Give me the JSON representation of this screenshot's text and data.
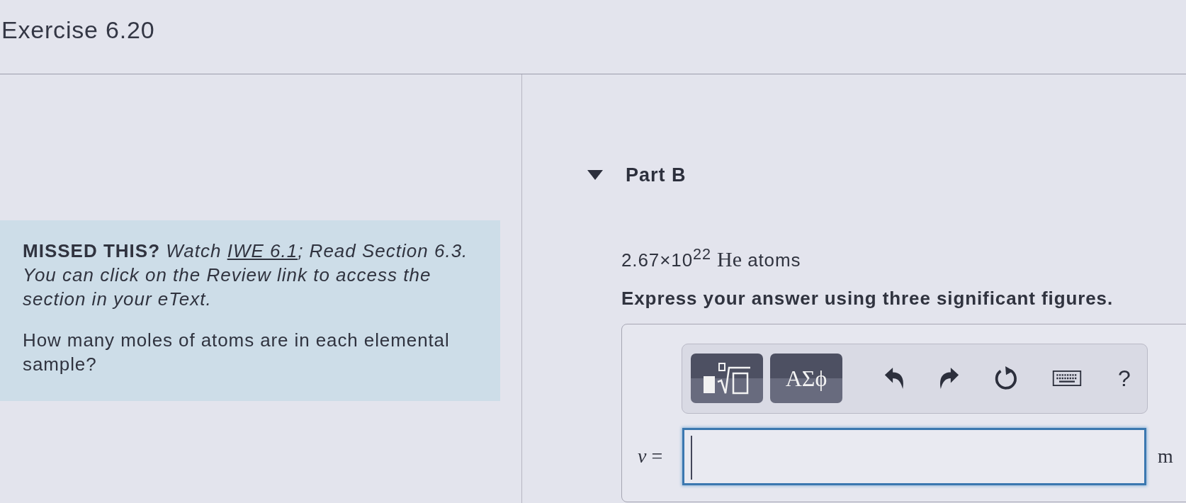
{
  "header": {
    "title": "Exercise 6.20"
  },
  "hint": {
    "label": "MISSED THIS?",
    "before_link": "Watch",
    "link": "IWE 6.1",
    "after_link": "; Read Section 6.3. You can click on the Review link to access the section in your eText."
  },
  "question": "How many moles of atoms are in each elemental sample?",
  "part": {
    "title": "Part B",
    "expanded": true,
    "sample": {
      "quantity": "2.67×10$^{22}$",
      "species": "He",
      "unit": "atoms"
    },
    "instruction": "Express your answer using three significant figures.",
    "toolbar": [
      {
        "kind": "templates"
      },
      {
        "kind": "symbols",
        "label": "ΑΣϕ"
      },
      {
        "kind": "undo"
      },
      {
        "kind": "redo"
      },
      {
        "kind": "reset"
      },
      {
        "kind": "keyboard"
      },
      {
        "kind": "help",
        "label": "?"
      }
    ],
    "answer": {
      "label": "*ν* =",
      "focused": true,
      "unit": "m"
    }
  }
}
